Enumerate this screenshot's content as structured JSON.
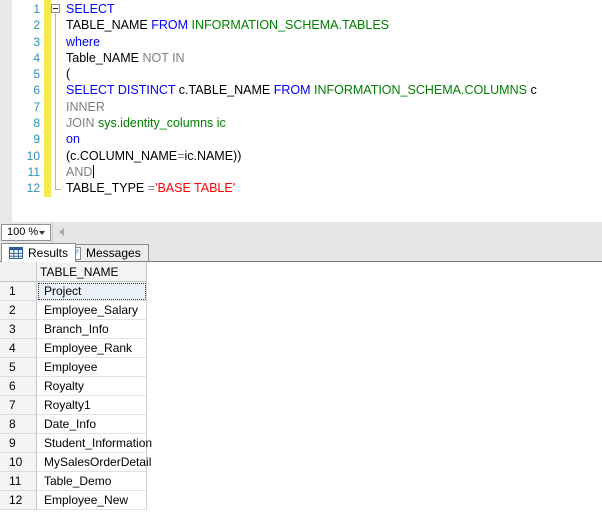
{
  "editor": {
    "lines": [
      {
        "n": "1",
        "collapse": true,
        "tokens": [
          [
            "kw",
            "SELECT"
          ]
        ]
      },
      {
        "n": "2",
        "tokens": [
          [
            "id",
            "TABLE_NAME "
          ],
          [
            "kw",
            "FROM"
          ],
          [
            "id",
            " "
          ],
          [
            "sys",
            "INFORMATION_SCHEMA.TABLES"
          ]
        ]
      },
      {
        "n": "3",
        "tokens": [
          [
            "kw",
            "where"
          ]
        ]
      },
      {
        "n": "4",
        "tokens": [
          [
            "id",
            "Table_NAME "
          ],
          [
            "op",
            "NOT IN"
          ]
        ]
      },
      {
        "n": "5",
        "tokens": [
          [
            "id",
            "("
          ]
        ]
      },
      {
        "n": "6",
        "tokens": [
          [
            "kw",
            "SELECT DISTINCT "
          ],
          [
            "id",
            "c.TABLE_NAME "
          ],
          [
            "kw",
            "FROM "
          ],
          [
            "sys",
            "INFORMATION_SCHEMA.COLUMNS "
          ],
          [
            "id",
            "c"
          ]
        ]
      },
      {
        "n": "7",
        "tokens": [
          [
            "op",
            "INNER"
          ]
        ]
      },
      {
        "n": "8",
        "tokens": [
          [
            "op",
            "JOIN "
          ],
          [
            "sys",
            "sys.identity_columns ic"
          ]
        ]
      },
      {
        "n": "9",
        "tokens": [
          [
            "kw",
            "on"
          ]
        ]
      },
      {
        "n": "10",
        "tokens": [
          [
            "id",
            "(c.COLUMN_NAME"
          ],
          [
            "op",
            "="
          ],
          [
            "id",
            "ic.NAME))"
          ]
        ]
      },
      {
        "n": "11",
        "tokens": [
          [
            "op",
            "AND"
          ]
        ],
        "caret": true
      },
      {
        "n": "12",
        "tokens": [
          [
            "id",
            "TABLE_TYPE "
          ],
          [
            "op",
            "="
          ],
          [
            "str",
            "'BASE TABLE'"
          ]
        ]
      }
    ]
  },
  "status_bar": {
    "zoom_value": "100 %"
  },
  "tabs": [
    {
      "label": "Results",
      "icon": "results-grid-icon",
      "active": true
    },
    {
      "label": "Messages",
      "icon": "messages-icon",
      "active": false
    }
  ],
  "results_grid": {
    "columns": [
      "TABLE_NAME"
    ],
    "rows": [
      [
        "1",
        "Project"
      ],
      [
        "2",
        "Employee_Salary"
      ],
      [
        "3",
        "Branch_Info"
      ],
      [
        "4",
        "Employee_Rank"
      ],
      [
        "5",
        "Employee"
      ],
      [
        "6",
        "Royalty"
      ],
      [
        "7",
        "Royalty1"
      ],
      [
        "8",
        "Date_Info"
      ],
      [
        "9",
        "Student_Information"
      ],
      [
        "10",
        "MySalesOrderDetail"
      ],
      [
        "11",
        "Table_Demo"
      ],
      [
        "12",
        "Employee_New"
      ]
    ],
    "selected": {
      "row_index": 0,
      "column": "TABLE_NAME"
    }
  },
  "colors": {
    "keyword": "#0000FF",
    "system_object": "#008000",
    "operator_gray": "#808080",
    "string": "#FF0000",
    "line_number": "#2B91AF",
    "track_changes_yellow": "#F5E94C"
  },
  "icons": {
    "results_tab": "results-grid-icon",
    "messages_tab": "messages-icon",
    "zoom_dropdown": "dropdown-arrow-icon",
    "scroll_left": "scroll-left-arrow-icon"
  }
}
